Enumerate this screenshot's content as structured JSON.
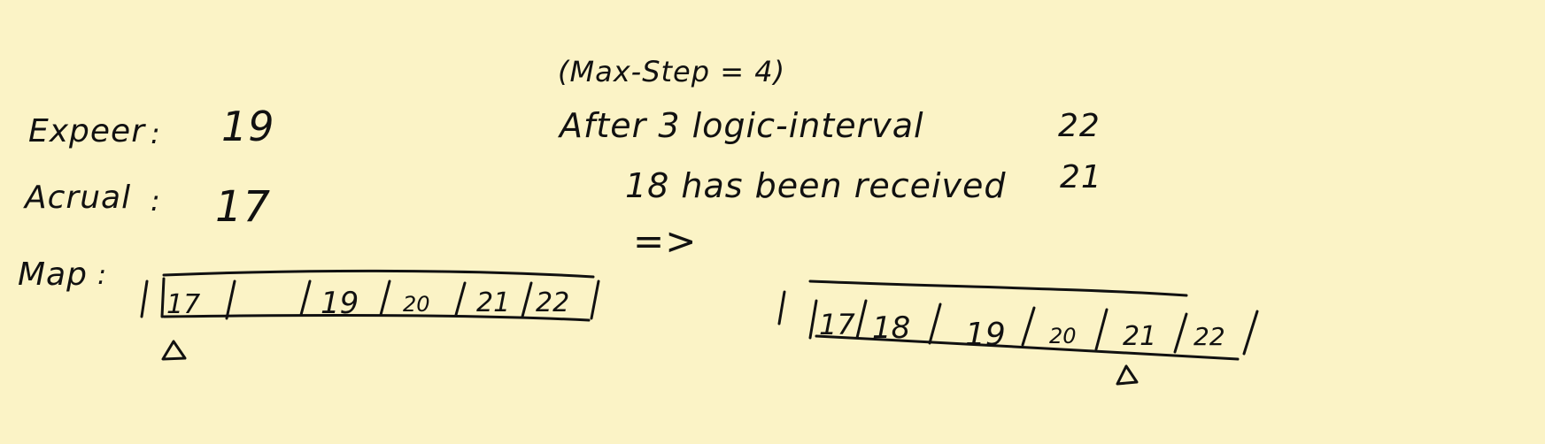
{
  "left": {
    "expect_label": "Expeer",
    "expect_sep": ":",
    "expect_value": "19",
    "actual_label": "Acrual",
    "actual_sep": ":",
    "actual_value": "17",
    "map_label": "Map",
    "map_sep": ":",
    "map_cells": [
      "17",
      "",
      "19",
      "20",
      "21",
      "22"
    ]
  },
  "middle": {
    "max_step_note": "(Max-Step = 4)",
    "line1": "After 3 logic-interval",
    "line2": "18 has been received",
    "arrow": "=>"
  },
  "right": {
    "value_top": "22",
    "value_bottom": "21",
    "map_cells": [
      "17",
      "18",
      "19",
      "20",
      "21",
      "22"
    ]
  }
}
